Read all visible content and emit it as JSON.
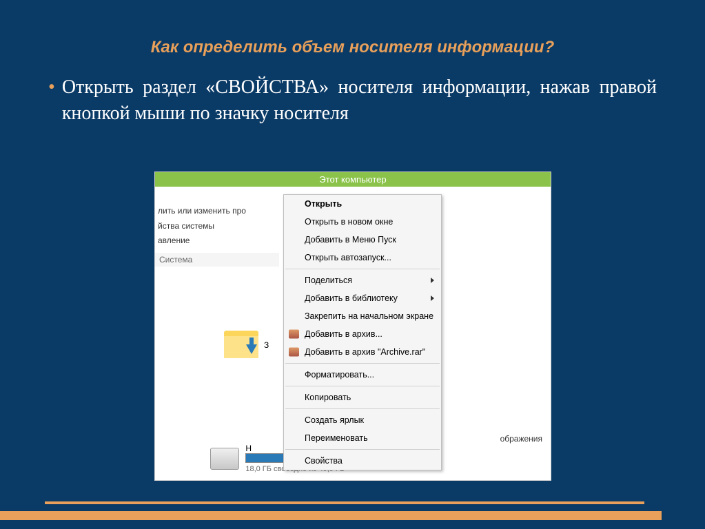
{
  "slide": {
    "title": "Как определить объем носителя информации?",
    "body": "Открыть раздел «СВОЙСТВА» носителя информации, нажав правой кнопкой мыши по значку носителя"
  },
  "explorer": {
    "window_title": "Этот компьютер",
    "left_links": [
      "лить или изменить про",
      "йства системы",
      "авление"
    ],
    "section_label": "Система",
    "folder_partial_label": "З",
    "right_partial_label": "ображения",
    "drive": {
      "name": "Н",
      "free_text": "18,0 ГБ свободно из 49,9 ГБ"
    }
  },
  "context_menu": {
    "items": [
      {
        "label": "Открыть",
        "bold": true
      },
      {
        "label": "Открыть в новом окне"
      },
      {
        "label": "Добавить в Меню Пуск"
      },
      {
        "label": "Открыть автозапуск..."
      },
      {
        "sep": true
      },
      {
        "label": "Поделиться",
        "submenu": true
      },
      {
        "label": "Добавить в библиотеку",
        "submenu": true
      },
      {
        "label": "Закрепить на начальном экране"
      },
      {
        "label": "Добавить в архив...",
        "icon": true
      },
      {
        "label": "Добавить в архив \"Archive.rar\"",
        "icon": true
      },
      {
        "sep": true
      },
      {
        "label": "Форматировать..."
      },
      {
        "sep": true
      },
      {
        "label": "Копировать"
      },
      {
        "sep": true
      },
      {
        "label": "Создать ярлык"
      },
      {
        "label": "Переименовать"
      },
      {
        "sep": true
      },
      {
        "label": "Свойства"
      }
    ]
  }
}
